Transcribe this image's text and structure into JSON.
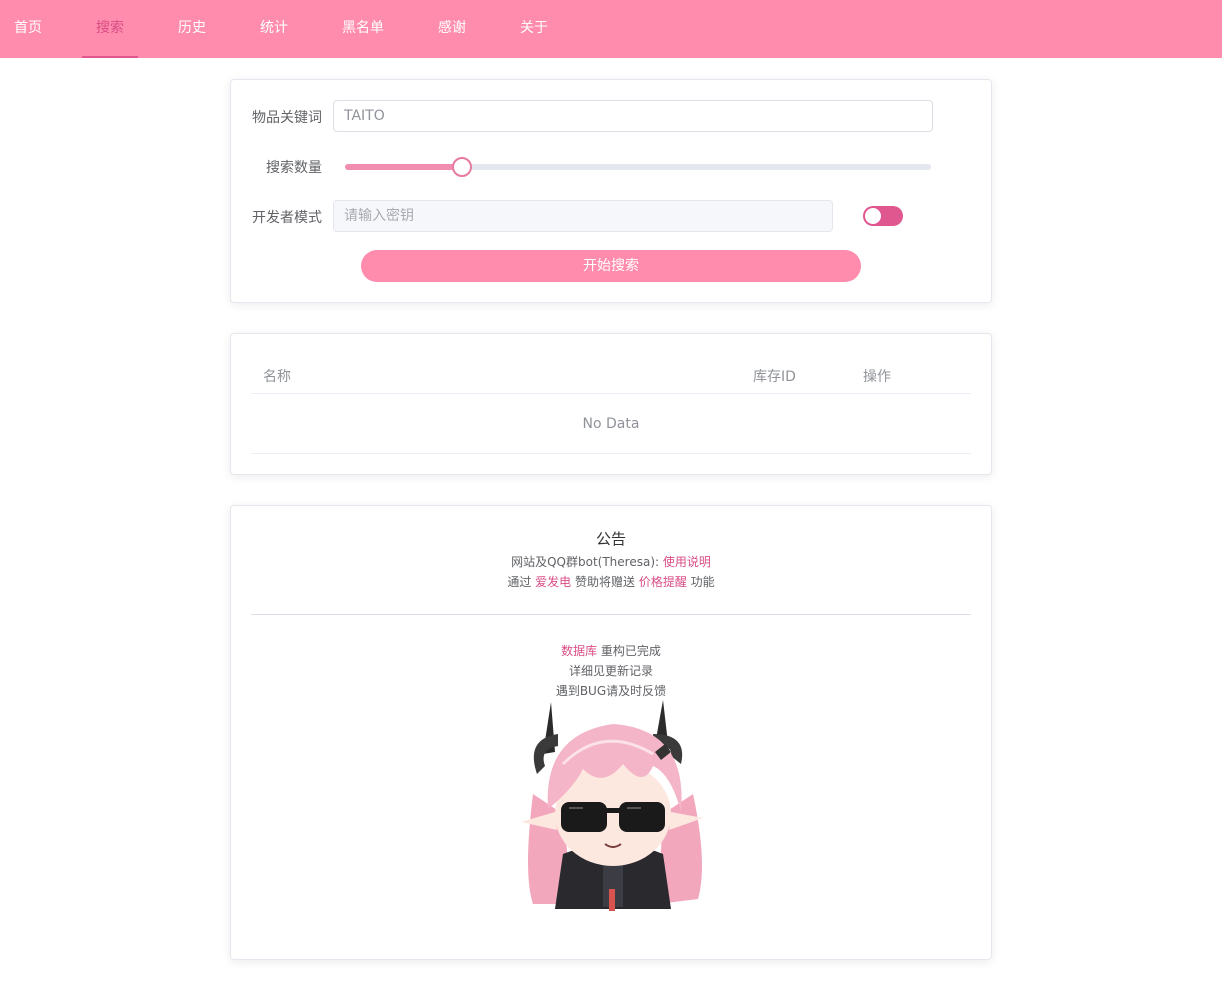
{
  "nav": {
    "items": [
      {
        "label": "首页",
        "active": false
      },
      {
        "label": "搜索",
        "active": true
      },
      {
        "label": "历史",
        "active": false
      },
      {
        "label": "统计",
        "active": false
      },
      {
        "label": "黑名单",
        "active": false
      },
      {
        "label": "感谢",
        "active": false
      },
      {
        "label": "关于",
        "active": false
      }
    ]
  },
  "search_form": {
    "keyword_label": "物品关键词",
    "keyword_value": "TAITO",
    "count_label": "搜索数量",
    "count_slider_fraction": 0.2,
    "dev_mode_label": "开发者模式",
    "dev_key_placeholder": "请输入密钥",
    "dev_mode_toggle_on": false,
    "submit_label": "开始搜索"
  },
  "results_table": {
    "columns": [
      "名称",
      "库存ID",
      "操作"
    ],
    "empty_text": "No Data"
  },
  "notice": {
    "title": "公告",
    "line1_prefix": "网站及QQ群bot(Theresa): ",
    "line1_link": "使用说明",
    "line2_prefix": "通过 ",
    "line2_link1": "爱发电",
    "line2_mid": " 赞助将赠送 ",
    "line2_link2": "价格提醒",
    "line2_suffix": " 功能",
    "line3_link": "数据库",
    "line3_suffix": " 重构已完成",
    "line4": "详细见更新记录",
    "line5": "遇到BUG请及时反馈",
    "image": "chibi-character-with-sunglasses"
  },
  "colors": {
    "nav_bg": "#ff8cad",
    "accent": "#e0568f",
    "link": "#d94e86"
  }
}
